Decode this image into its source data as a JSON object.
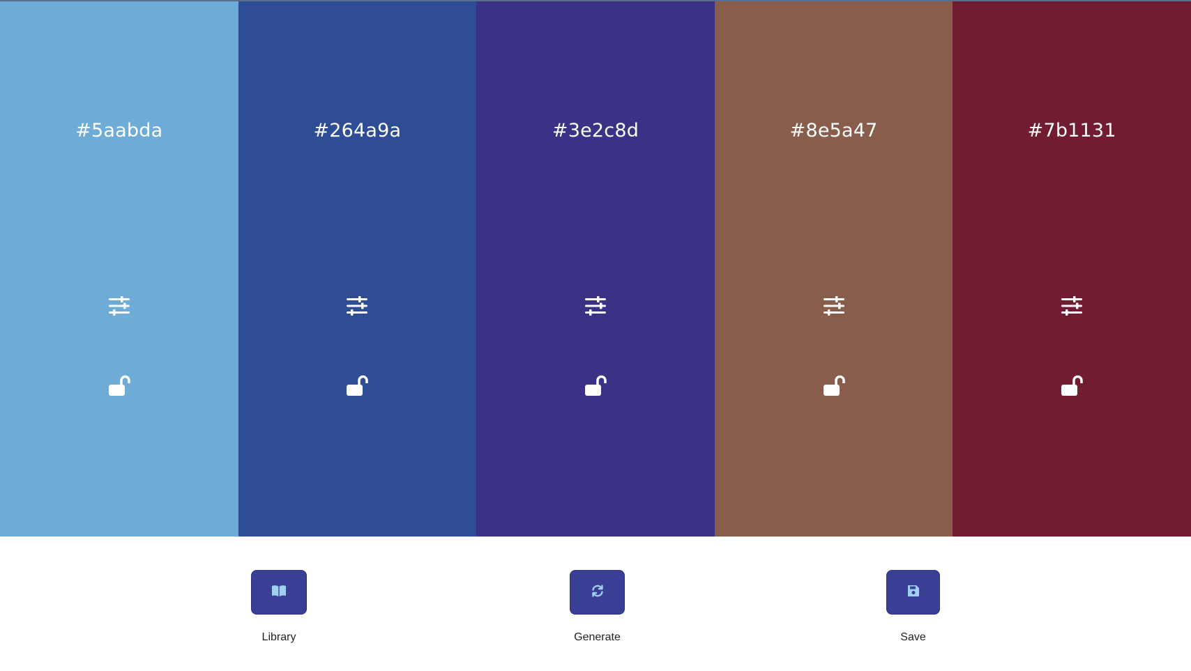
{
  "palette": {
    "swatches": [
      {
        "hex_label": "#5aabda",
        "color": "#6eabd6",
        "icons": [
          "sliders-icon",
          "unlock-icon"
        ]
      },
      {
        "hex_label": "#264a9a",
        "color": "#2e4d94",
        "icons": [
          "sliders-icon",
          "unlock-icon"
        ]
      },
      {
        "hex_label": "#3e2c8d",
        "color": "#3b3185",
        "icons": [
          "sliders-icon",
          "unlock-icon"
        ]
      },
      {
        "hex_label": "#8e5a47",
        "color": "#885d4b",
        "icons": [
          "sliders-icon",
          "unlock-icon"
        ]
      },
      {
        "hex_label": "#7b1131",
        "color": "#721c31",
        "icons": [
          "sliders-icon",
          "unlock-icon"
        ]
      }
    ]
  },
  "controls": {
    "library": {
      "label": "Library",
      "icon": "book-icon"
    },
    "generate": {
      "label": "Generate",
      "icon": "refresh-icon"
    },
    "save": {
      "label": "Save",
      "icon": "save-icon"
    }
  },
  "colors": {
    "button_bg": "#3a3f95",
    "icon_accent": "#9fd0f0"
  }
}
